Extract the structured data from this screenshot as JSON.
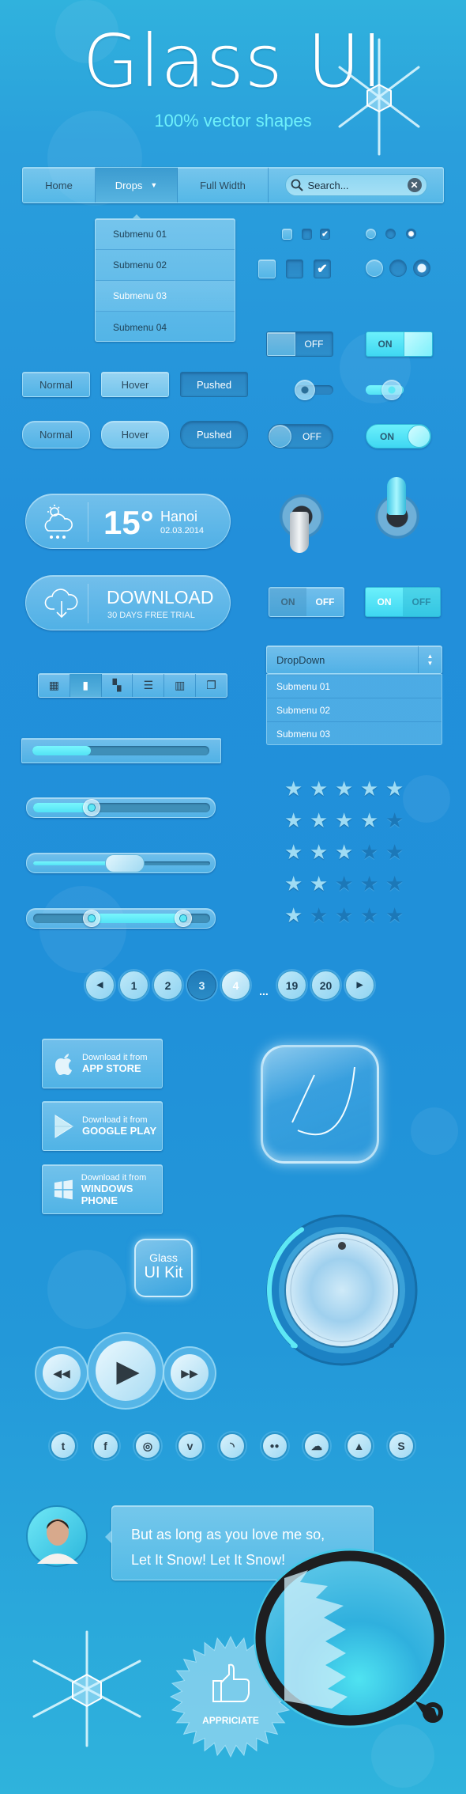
{
  "header": {
    "title": "Glass UI",
    "subtitle": "100% vector shapes"
  },
  "nav": {
    "items": [
      {
        "label": "Home",
        "active": false
      },
      {
        "label": "Drops",
        "active": true,
        "has_dropdown": true
      },
      {
        "label": "Full Width",
        "active": false
      }
    ],
    "search": {
      "placeholder": "Search...",
      "icon": "search-icon",
      "clear_icon": "close-icon"
    }
  },
  "drops_menu": {
    "items": [
      "Submenu 01",
      "Submenu 02",
      "Submenu 03",
      "Submenu 04"
    ],
    "selected_index": 2
  },
  "checkboxes": {
    "small": [
      {
        "state": "normal"
      },
      {
        "state": "pressed"
      },
      {
        "state": "checked"
      }
    ],
    "large": [
      {
        "state": "normal"
      },
      {
        "state": "pressed"
      },
      {
        "state": "checked"
      }
    ]
  },
  "radios": {
    "small": [
      {
        "state": "normal"
      },
      {
        "state": "pressed"
      },
      {
        "state": "selected"
      }
    ],
    "large": [
      {
        "state": "normal"
      },
      {
        "state": "pressed"
      },
      {
        "state": "selected"
      }
    ]
  },
  "toggles": {
    "square_off": {
      "label": "OFF"
    },
    "square_on": {
      "label": "ON"
    },
    "round_off": {
      "label": "OFF"
    },
    "round_on": {
      "label": "ON"
    },
    "split_off": {
      "on_label": "ON",
      "off_label": "OFF",
      "state": "off"
    },
    "split_on": {
      "on_label": "ON",
      "off_label": "OFF",
      "state": "on"
    }
  },
  "buttons": {
    "square": [
      {
        "label": "Normal"
      },
      {
        "label": "Hover"
      },
      {
        "label": "Pushed"
      }
    ],
    "rounded": [
      {
        "label": "Normal"
      },
      {
        "label": "Hover"
      },
      {
        "label": "Pushed"
      }
    ]
  },
  "weather": {
    "temperature": "15°",
    "city": "Hanoi",
    "date": "02.03.2014",
    "icon": "cloud-rain-sun-icon"
  },
  "download": {
    "title": "DOWNLOAD",
    "subtitle": "30 DAYS FREE TRIAL",
    "icon": "cloud-download-icon"
  },
  "view_switcher": {
    "items": [
      "grid-small-icon",
      "carousel-icon",
      "grid-large-icon",
      "list-icon",
      "columns-icon",
      "windows-icon"
    ],
    "glyphs": [
      "▦",
      "▮",
      "▚",
      "☰",
      "▥",
      "❐"
    ],
    "active_index": 1
  },
  "dropdown": {
    "selected": "DropDown",
    "options": [
      "Submenu 01",
      "Submenu 02",
      "Submenu 03"
    ]
  },
  "progress": {
    "value": 0.33
  },
  "sliders": [
    {
      "type": "single",
      "value": 0.33
    },
    {
      "type": "handle",
      "value": 0.52
    },
    {
      "type": "range",
      "low": 0.33,
      "high": 0.85
    }
  ],
  "ratings": [
    5,
    4,
    3,
    2,
    1
  ],
  "rating_max": 5,
  "pagination": {
    "prev_icon": "prev-arrow-icon",
    "next_icon": "next-arrow-icon",
    "pages": [
      "1",
      "2",
      "3",
      "4",
      "19",
      "20"
    ],
    "current": "3",
    "hover": "4",
    "ellipsis": "..."
  },
  "store_buttons": [
    {
      "line1": "Download it from",
      "line2": "APP STORE",
      "icon": "apple-icon"
    },
    {
      "line1": "Download it from",
      "line2": "GOOGLE PLAY",
      "icon": "google-play-icon"
    },
    {
      "line1": "Download it from",
      "line2": "WINDOWS PHONE",
      "icon": "windows-icon"
    }
  ],
  "app_icon": {
    "icon": "leaf-icon"
  },
  "kit_badge": {
    "line1": "Glass",
    "line2": "UI Kit"
  },
  "volume_knob": {
    "value": 0.38
  },
  "media_player": {
    "rewind": "rewind-icon",
    "play": "play-icon",
    "forward": "fast-forward-icon"
  },
  "social": [
    {
      "name": "twitter-icon",
      "glyph": "🐦"
    },
    {
      "name": "facebook-icon",
      "glyph": "f"
    },
    {
      "name": "dribbble-icon",
      "glyph": "◎"
    },
    {
      "name": "vimeo-icon",
      "glyph": "v"
    },
    {
      "name": "rss-icon",
      "glyph": "◝"
    },
    {
      "name": "flickr-icon",
      "glyph": "●●"
    },
    {
      "name": "cloud-icon",
      "glyph": "☁"
    },
    {
      "name": "forrst-icon",
      "glyph": "▲"
    },
    {
      "name": "skype-icon",
      "glyph": "S"
    }
  ],
  "chat": {
    "message_line1": "But as long as you love me so,",
    "message_line2": "Let It Snow! Let It Snow!"
  },
  "badge": {
    "label": "APPRICIATE",
    "icon": "thumbs-up-icon"
  },
  "colors": {
    "accent": "#5ee8f5",
    "background": "#2090d9",
    "dark_text": "#2b4a5e"
  }
}
